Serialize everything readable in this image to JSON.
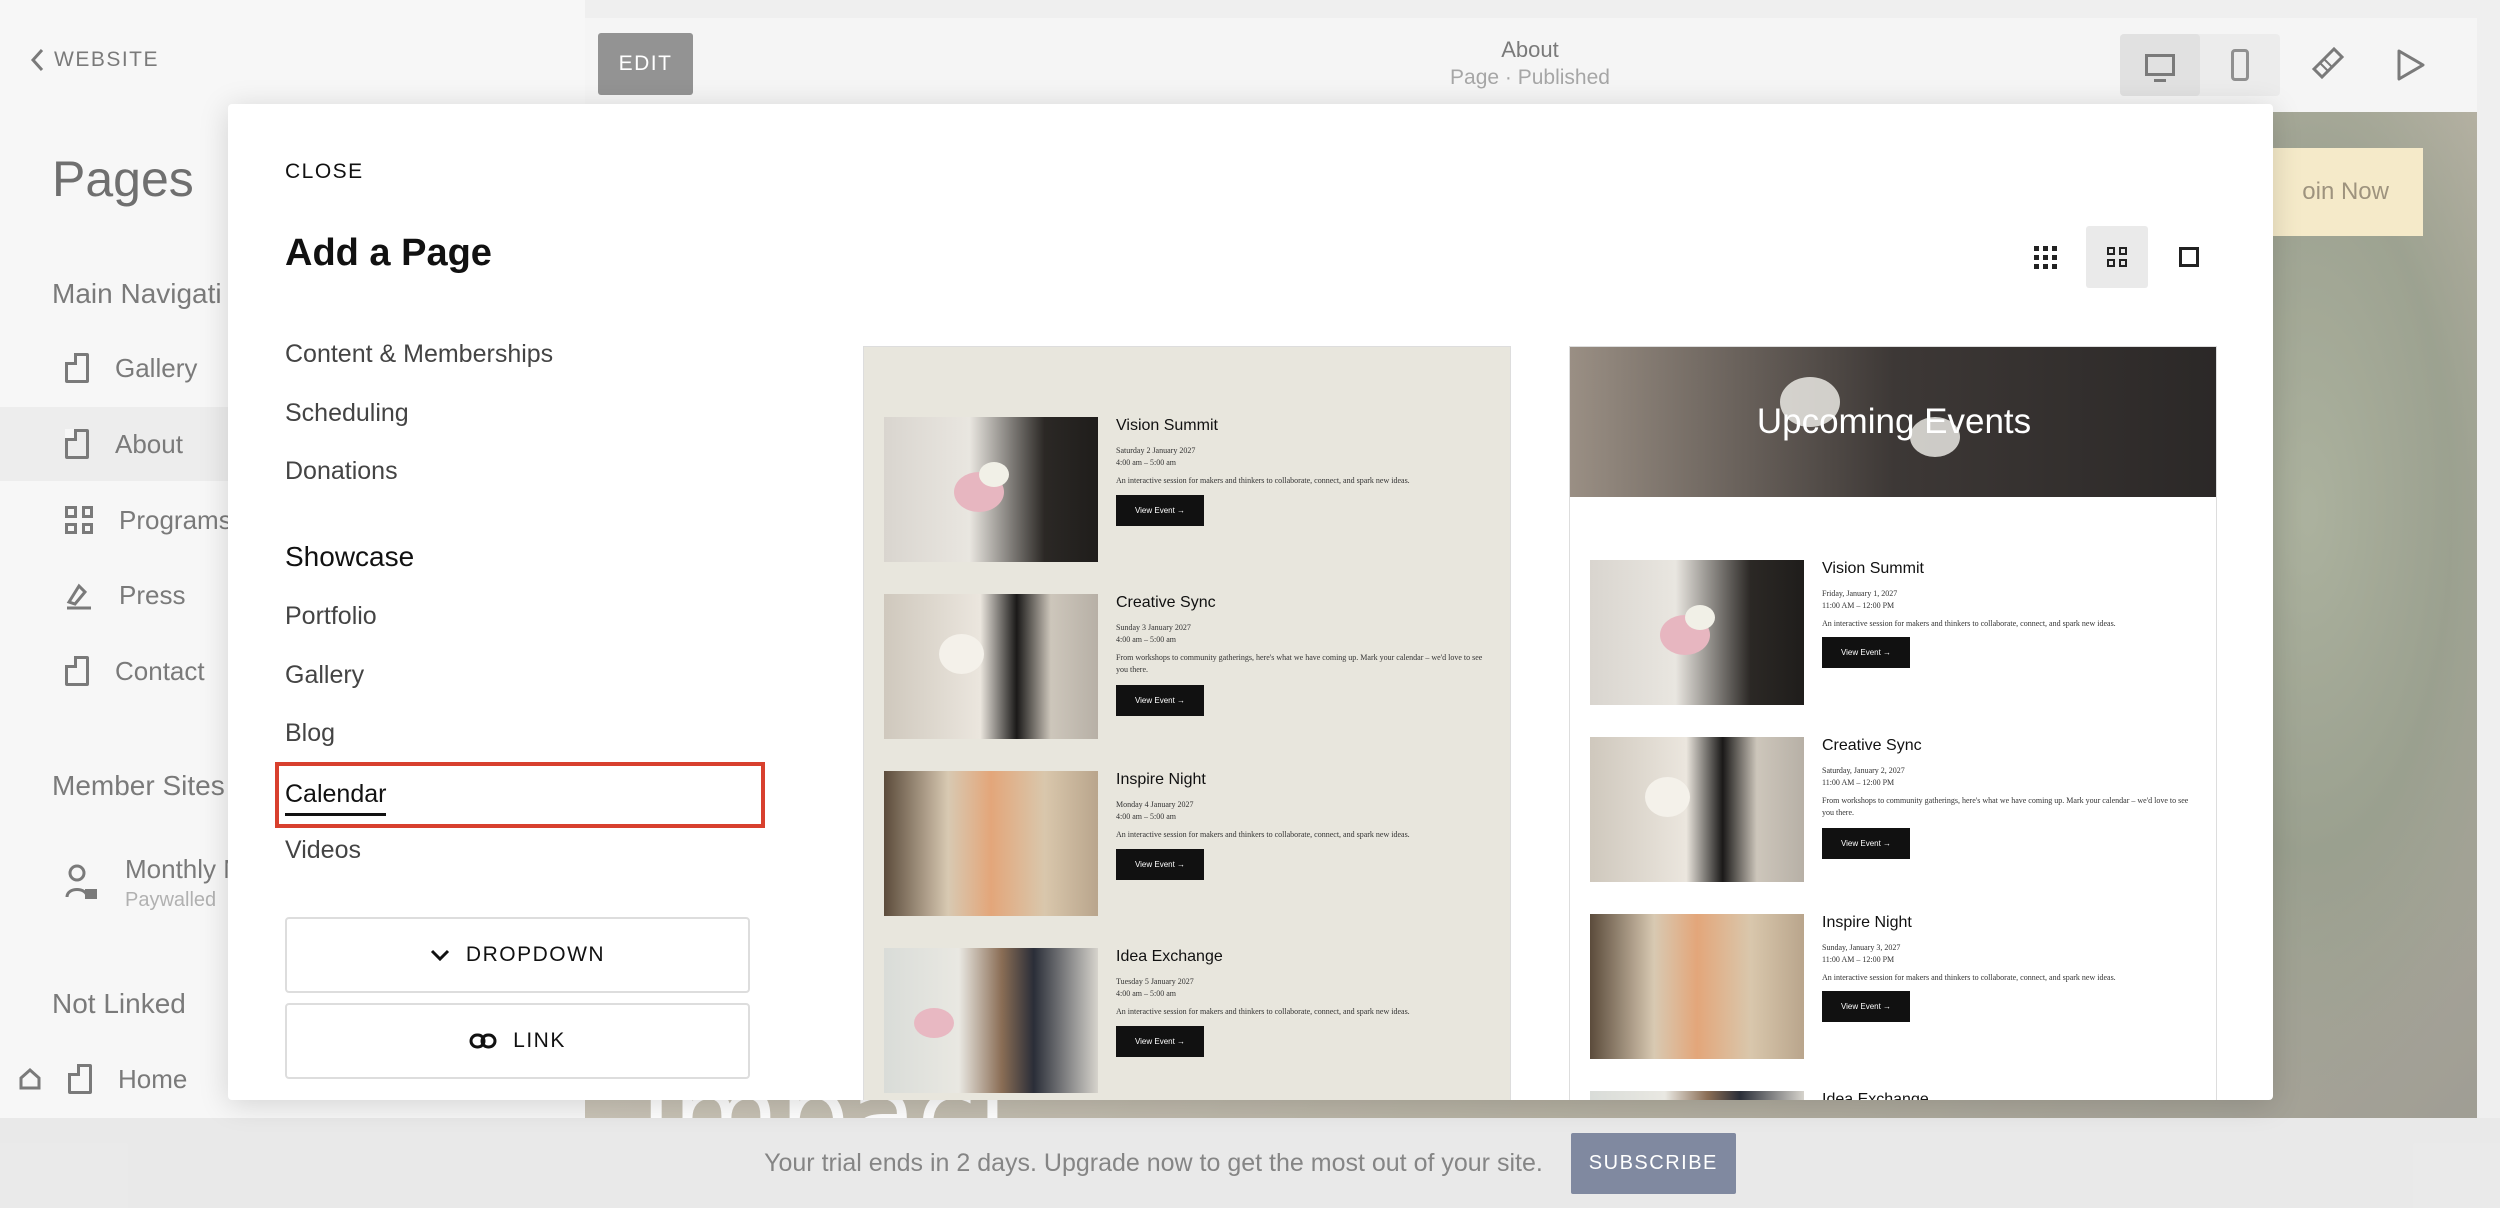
{
  "sidebar": {
    "back_label": "WEBSITE",
    "title": "Pages",
    "main_nav_label": "Main Navigati",
    "items": [
      {
        "label": "Gallery"
      },
      {
        "label": "About"
      },
      {
        "label": "Programs"
      },
      {
        "label": "Press"
      },
      {
        "label": "Contact"
      }
    ],
    "member_sites_label": "Member Sites",
    "member_item": {
      "label": "Monthly M",
      "sub": "Paywalled"
    },
    "not_linked_label": "Not Linked",
    "home_label": "Home"
  },
  "topbar": {
    "edit_label": "EDIT",
    "page_title": "About",
    "page_status": "Page · Published"
  },
  "preview": {
    "join_label": "oin Now",
    "impact_text": "Impact."
  },
  "trial": {
    "message": "Your trial ends in 2 days. Upgrade now to get the most out of your site.",
    "subscribe_label": "SUBSCRIBE"
  },
  "modal": {
    "close_label": "CLOSE",
    "title": "Add a Page",
    "categories_top": [
      "Content & Memberships",
      "Scheduling",
      "Donations"
    ],
    "showcase_heading": "Showcase",
    "showcase_items": [
      "Portfolio",
      "Gallery",
      "Blog",
      "Calendar",
      "Videos"
    ],
    "selected_category": "Calendar",
    "dropdown_label": "DROPDOWN",
    "link_label": "LINK"
  },
  "template_a": {
    "events": [
      {
        "title": "Vision Summit",
        "date": "Saturday 2 January 2027\n4:00 am – 5:00 am",
        "desc": "An interactive session for makers and thinkers to collaborate, connect, and spark new ideas.",
        "button": "View Event →"
      },
      {
        "title": "Creative Sync",
        "date": "Sunday 3 January 2027\n4:00 am – 5:00 am",
        "desc": "From workshops to community gatherings, here's what we have coming up. Mark your calendar – we'd love to see you there.",
        "button": "View Event →"
      },
      {
        "title": "Inspire Night",
        "date": "Monday 4 January 2027\n4:00 am – 5:00 am",
        "desc": "An interactive session for makers and thinkers to collaborate, connect, and spark new ideas.",
        "button": "View Event →"
      },
      {
        "title": "Idea Exchange",
        "date": "Tuesday 5 January 2027\n4:00 am – 5:00 am",
        "desc": "An interactive session for makers and thinkers to collaborate, connect, and spark new ideas.",
        "button": "View Event →"
      }
    ]
  },
  "template_b": {
    "hero_title": "Upcoming Events",
    "events": [
      {
        "title": "Vision Summit",
        "date": "Friday, January 1, 2027\n11:00 AM – 12:00 PM",
        "desc": "An interactive session for makers and thinkers to collaborate, connect, and spark new ideas.",
        "button": "View Event →"
      },
      {
        "title": "Creative Sync",
        "date": "Saturday, January 2, 2027\n11:00 AM – 12:00 PM",
        "desc": "From workshops to community gatherings, here's what we have coming up. Mark your calendar – we'd love to see you there.",
        "button": "View Event →"
      },
      {
        "title": "Inspire Night",
        "date": "Sunday, January 3, 2027\n11:00 AM – 12:00 PM",
        "desc": "An interactive session for makers and thinkers to collaborate, connect, and spark new ideas.",
        "button": "View Event →"
      },
      {
        "title": "Idea Exchange"
      }
    ]
  },
  "colors": {
    "selection_outline": "#d8402e",
    "subscribe_bg": "#3d4b6e",
    "join_bg": "#f0dfad"
  },
  "icons": [
    "chevron-left-icon",
    "page-icon",
    "grid-icon",
    "press-icon",
    "member-lock-icon",
    "home-icon",
    "desktop-icon",
    "mobile-icon",
    "brush-icon",
    "play-icon",
    "grid-small-view-icon",
    "grid-medium-view-icon",
    "single-view-icon",
    "chevron-down-icon",
    "link-icon"
  ]
}
